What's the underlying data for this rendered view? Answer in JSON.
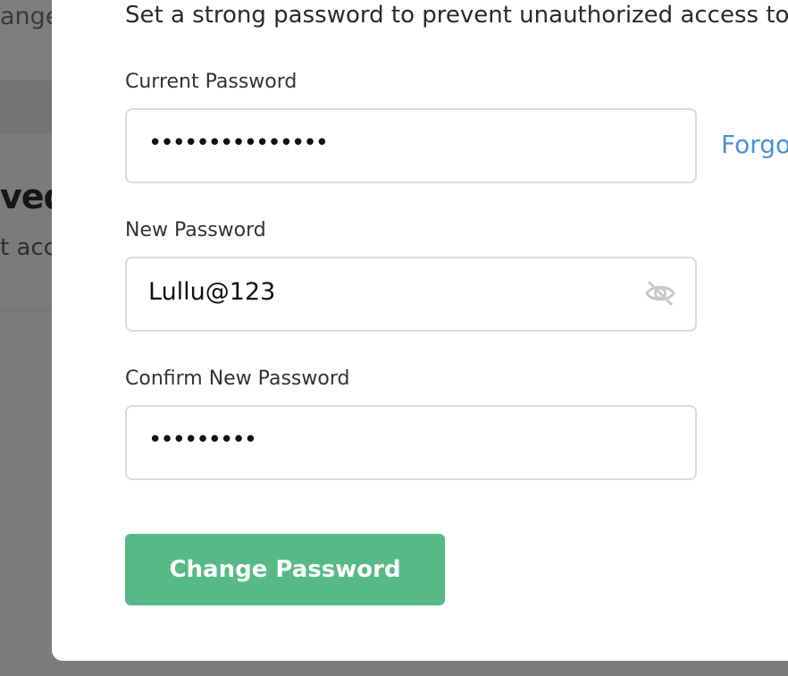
{
  "background": {
    "fragment_1": "ange",
    "fragment_2": "ved",
    "fragment_3": "t acc"
  },
  "modal": {
    "description": "Set a strong password to prevent unauthorized access to y",
    "current_password": {
      "label": "Current Password",
      "value": "•••••••••••••••",
      "forgot_link": "Forgo"
    },
    "new_password": {
      "label": "New Password",
      "value": "Lullu@123",
      "toggle_icon": "eye-slash-icon"
    },
    "confirm_password": {
      "label": "Confirm New Password",
      "value": "•••••••••"
    },
    "submit_label": "Change Password"
  },
  "colors": {
    "overlay": "#7b7b7b",
    "modal_bg": "#ffffff",
    "field_border": "#dcdcdc",
    "link": "#4a90d6",
    "button": "#57ba86",
    "button_text": "#ffffff"
  }
}
